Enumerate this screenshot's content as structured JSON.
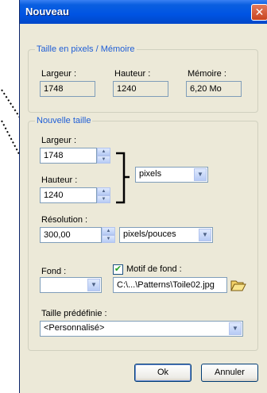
{
  "window": {
    "title": "Nouveau",
    "close_glyph": "✕"
  },
  "size_group": {
    "legend": "Taille en pixels / Mémoire",
    "largeur_label": "Largeur :",
    "largeur_value": "1748",
    "hauteur_label": "Hauteur :",
    "hauteur_value": "1240",
    "memoire_label": "Mémoire :",
    "memoire_value": "6,20 Mo"
  },
  "new_size_group": {
    "legend": "Nouvelle taille",
    "largeur_label": "Largeur :",
    "largeur_value": "1748",
    "hauteur_label": "Hauteur :",
    "hauteur_value": "1240",
    "unit": "pixels",
    "resolution_label": "Résolution :",
    "resolution_value": "300,00",
    "resolution_unit": "pixels/pouces",
    "fond_label": "Fond :",
    "fond_color": "#ffffff",
    "motif_label": "Motif de fond :",
    "motif_checked": true,
    "motif_path": "C:\\...\\Patterns\\Toile02.jpg",
    "preset_label": "Taille prédéfinie :",
    "preset_value": "<Personnalisé>"
  },
  "buttons": {
    "ok": "Ok",
    "cancel": "Annuler"
  },
  "icons": {
    "spin_up": "▲",
    "spin_down": "▼",
    "dropdown": "▼",
    "check": "✔",
    "folder": "folder-open-icon"
  }
}
